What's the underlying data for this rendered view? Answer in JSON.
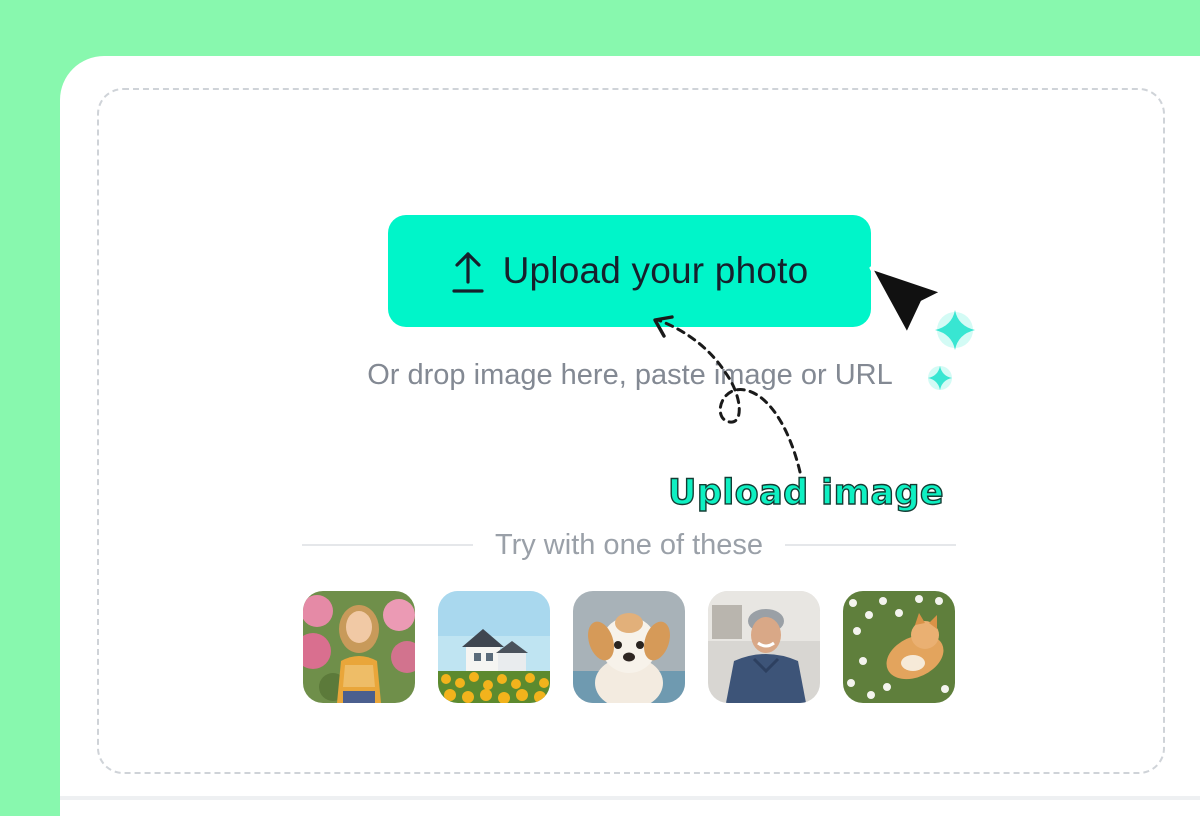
{
  "upload": {
    "button_label": "Upload your photo",
    "hint": "Or drop image here, paste image or URL"
  },
  "annotation": {
    "text": "Upload image"
  },
  "samples": {
    "heading": "Try with one of these",
    "items": [
      {
        "subject": "girl-portrait"
      },
      {
        "subject": "house-in-field"
      },
      {
        "subject": "puppy"
      },
      {
        "subject": "man-smiling"
      },
      {
        "subject": "cat-in-flowers"
      }
    ]
  },
  "colors": {
    "background": "#88f8ae",
    "accent": "#00f5c9",
    "annotation_fill": "#0ef0c2",
    "annotation_outline": "#143c33",
    "hint_text": "#838993",
    "dashed_border": "#cfd3d8"
  },
  "icons": {
    "upload": "upload-arrow-icon",
    "cursor": "pointer-cursor-icon",
    "sparkle": "sparkle-icon"
  }
}
